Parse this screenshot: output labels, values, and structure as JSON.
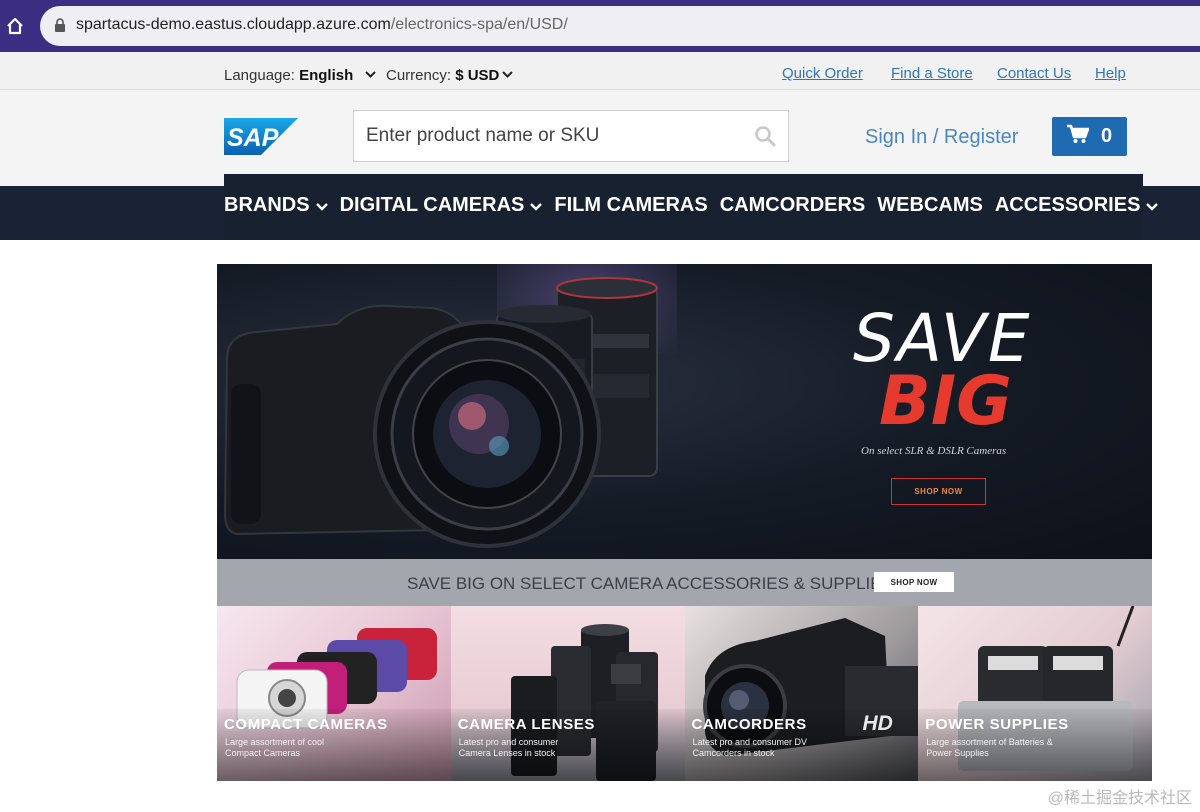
{
  "browser": {
    "url_host": "spartacus-demo.eastus.cloudapp.azure.com",
    "url_path": "/electronics-spa/en/USD/"
  },
  "utility": {
    "language_label": "Language:",
    "language_value": "English",
    "currency_label": "Currency:",
    "currency_value": "$ USD",
    "links": [
      "Quick Order",
      "Find a Store",
      "Contact Us",
      "Help"
    ]
  },
  "header": {
    "logo_text": "SAP",
    "search_placeholder": "Enter product name or SKU",
    "signin_label": "Sign In / Register",
    "cart_count": "0"
  },
  "nav": {
    "items": [
      "BRANDS",
      "DIGITAL CAMERAS",
      "FILM CAMERAS",
      "CAMCORDERS",
      "WEBCAMS",
      "ACCESSORIES"
    ]
  },
  "hero": {
    "headline_1": "SAVE",
    "headline_2": "BIG",
    "subtitle": "On select SLR & DSLR Cameras",
    "button": "SHOP NOW"
  },
  "promo": {
    "text": "SAVE BIG ON SELECT CAMERA ACCESSORIES & SUPPLIES",
    "button": "SHOP NOW"
  },
  "categories": [
    {
      "title": "COMPACT CAMERAS",
      "desc": "Large assortment of cool Compact Cameras"
    },
    {
      "title": "CAMERA LENSES",
      "desc": "Latest pro and consumer Camera Lenses in stock"
    },
    {
      "title": "CAMCORDERS",
      "desc": "Latest pro and consumer DV Camcorders in stock"
    },
    {
      "title": "POWER SUPPLIES",
      "desc": "Large assortment of Batteries & Power Supplies"
    }
  ],
  "camcorder_badge": "HD",
  "watermark": "@稀土掘金技术社区",
  "colors": {
    "browser_bar": "#3a2d82",
    "link_blue": "#2f76b5",
    "cart_blue": "#1f6bb2",
    "nav_dark": "#18212f",
    "big_red": "#e63a2e"
  }
}
